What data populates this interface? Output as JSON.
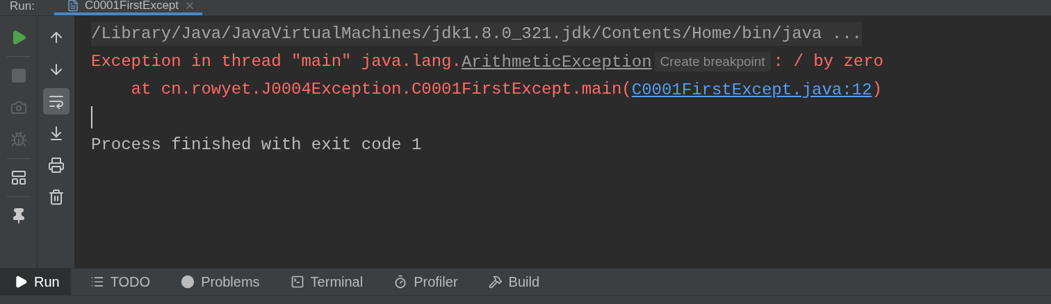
{
  "header": {
    "label": "Run:",
    "tab": {
      "title": "C0001FirstExcept",
      "selected": true
    }
  },
  "left_toolbar": [
    {
      "kind": "play",
      "disabled": false
    },
    {
      "kind": "stop",
      "disabled": true
    },
    {
      "kind": "camera",
      "disabled": true
    },
    {
      "kind": "debug",
      "disabled": true
    },
    {
      "kind": "layout",
      "disabled": false
    },
    {
      "kind": "pin",
      "disabled": false
    }
  ],
  "console_toolbar": [
    {
      "kind": "up",
      "selected": false
    },
    {
      "kind": "down",
      "selected": false
    },
    {
      "kind": "wrap",
      "selected": true
    },
    {
      "kind": "scroll-end",
      "selected": false
    },
    {
      "kind": "print",
      "selected": false
    },
    {
      "kind": "trash",
      "selected": false
    }
  ],
  "console": {
    "lines": [
      {
        "kind": "command",
        "segments": [
          {
            "kind": "text",
            "text": "/Library/Java/JavaVirtualMachines/jdk1.8.0_321.jdk/Contents/Home/bin/java ..."
          }
        ]
      },
      {
        "kind": "error",
        "segments": [
          {
            "kind": "text",
            "text": "Exception in thread \"main\" java.lang."
          },
          {
            "kind": "class-link",
            "text": "ArithmeticException"
          },
          {
            "kind": "hint",
            "text": "Create breakpoint"
          },
          {
            "kind": "text",
            "text": ": / by zero"
          }
        ]
      },
      {
        "kind": "error",
        "segments": [
          {
            "kind": "text",
            "text": "    at cn.rowyet.J0004Exception.C0001FirstExcept.main("
          },
          {
            "kind": "file-link",
            "text": "C0001FirstExcept.java:12"
          },
          {
            "kind": "text",
            "text": ")"
          }
        ]
      },
      {
        "kind": "caret"
      },
      {
        "kind": "output",
        "segments": [
          {
            "kind": "text",
            "text": "Process finished with exit code 1"
          }
        ]
      }
    ]
  },
  "bottom_tabs": [
    {
      "kind": "run",
      "label": "Run",
      "selected": true
    },
    {
      "kind": "todo",
      "label": "TODO",
      "selected": false
    },
    {
      "kind": "problems",
      "label": "Problems",
      "selected": false
    },
    {
      "kind": "terminal",
      "label": "Terminal",
      "selected": false
    },
    {
      "kind": "profiler",
      "label": "Profiler",
      "selected": false
    },
    {
      "kind": "build",
      "label": "Build",
      "selected": false
    }
  ]
}
